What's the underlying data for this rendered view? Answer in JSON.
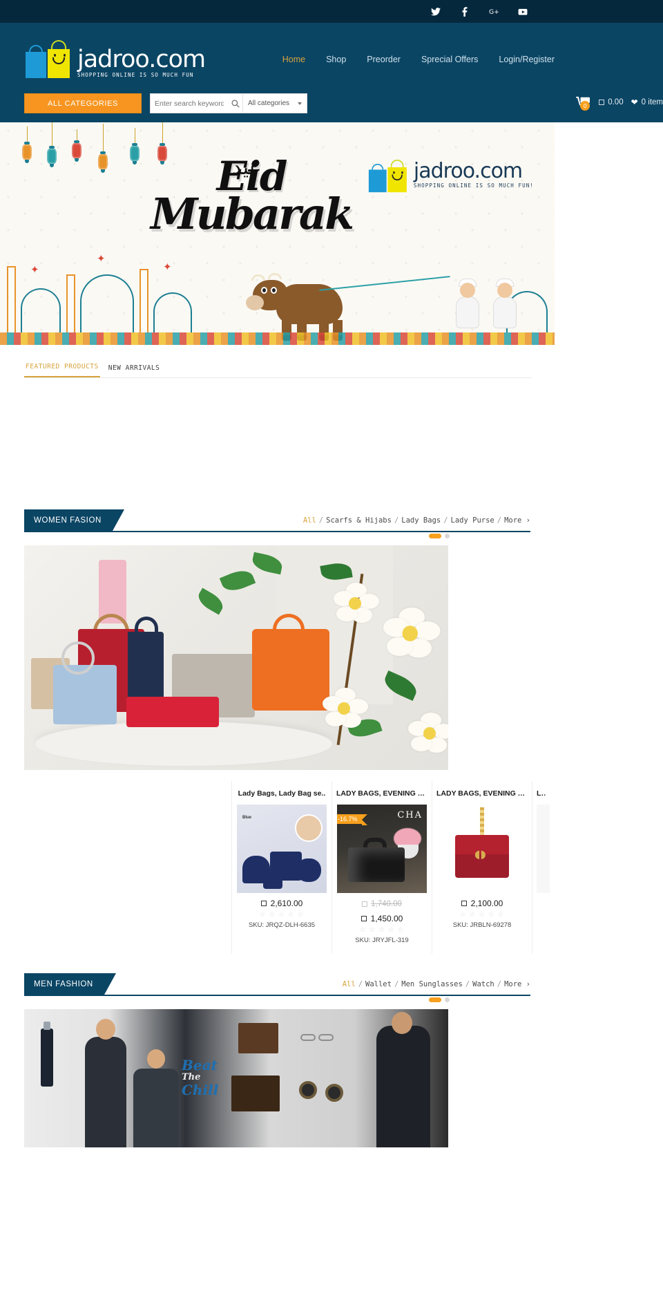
{
  "topbar": {
    "social": [
      {
        "name": "twitter-icon",
        "label": "Twitter"
      },
      {
        "name": "facebook-icon",
        "label": "Facebook"
      },
      {
        "name": "google-plus-icon",
        "label": "Google Plus"
      },
      {
        "name": "youtube-icon",
        "label": "YouTube"
      }
    ]
  },
  "header": {
    "logo_name": "jadroo.com",
    "logo_tagline": "SHOPPING ONLINE IS SO MUCH FUN",
    "nav": [
      {
        "label": "Home",
        "active": true
      },
      {
        "label": "Shop",
        "active": false
      },
      {
        "label": "Preorder",
        "active": false
      },
      {
        "label": "Sprecial Offers",
        "active": false
      },
      {
        "label": "Login/Register",
        "active": false
      }
    ]
  },
  "search": {
    "all_categories_button": "ALL CATEGORIES",
    "placeholder": "Enter search keywords",
    "value": "",
    "category_selected": "All categories"
  },
  "cart": {
    "count": "0",
    "amount": "0.00",
    "items": "0 item"
  },
  "banner": {
    "eid_line1": "Eid",
    "eid_line2": "Mubarak",
    "arabic": "عيد",
    "logo_name": "jadroo.com",
    "logo_tagline": "SHOPPING ONLINE IS SO MUCH FUN!"
  },
  "tabs": [
    {
      "label": "FEATURED PRODUCTS",
      "active": true
    },
    {
      "label": "NEW ARRIVALS",
      "active": false
    }
  ],
  "sections": [
    {
      "title": "WOMEN FASION",
      "links": [
        "All",
        "Scarfs & Hijabs",
        "Lady Bags",
        "Lady Purse",
        "More ›"
      ],
      "dots": 2,
      "active_dot": 0,
      "products": [
        {
          "title": "Lady Bags, Lady Bag se..",
          "price": "2,610.00",
          "old_price": null,
          "discount": null,
          "rating": 0,
          "sku": "SKU: JRQZ-DLH-6635"
        },
        {
          "title": "LADY BAGS, EVENING B...",
          "price": "1,450.00",
          "old_price": "1,740.00",
          "discount": "-16.7%",
          "rating": 0,
          "sku": "SKU: JRYJFL-319"
        },
        {
          "title": "LADY BAGS, EVENING B...",
          "price": "2,100.00",
          "old_price": null,
          "discount": null,
          "rating": 0,
          "sku": "SKU: JRBLN-69278"
        },
        {
          "title": "LADY",
          "price": "",
          "old_price": null,
          "discount": null,
          "rating": 0,
          "sku": ""
        }
      ]
    },
    {
      "title": "MEN FASHION",
      "links": [
        "All",
        "Wallet",
        "Men Sunglasses",
        "Watch",
        "More ›"
      ],
      "dots": 2,
      "active_dot": 0,
      "banner_text_top": "Beat",
      "banner_text_mid": "The",
      "banner_text_bot": "Chill"
    }
  ],
  "colors": {
    "topbar": "#06283d",
    "header": "#0b4564",
    "accent_orange": "#f7a01d",
    "accent_gold": "#d7a33c",
    "section_navy": "#0b4564"
  }
}
